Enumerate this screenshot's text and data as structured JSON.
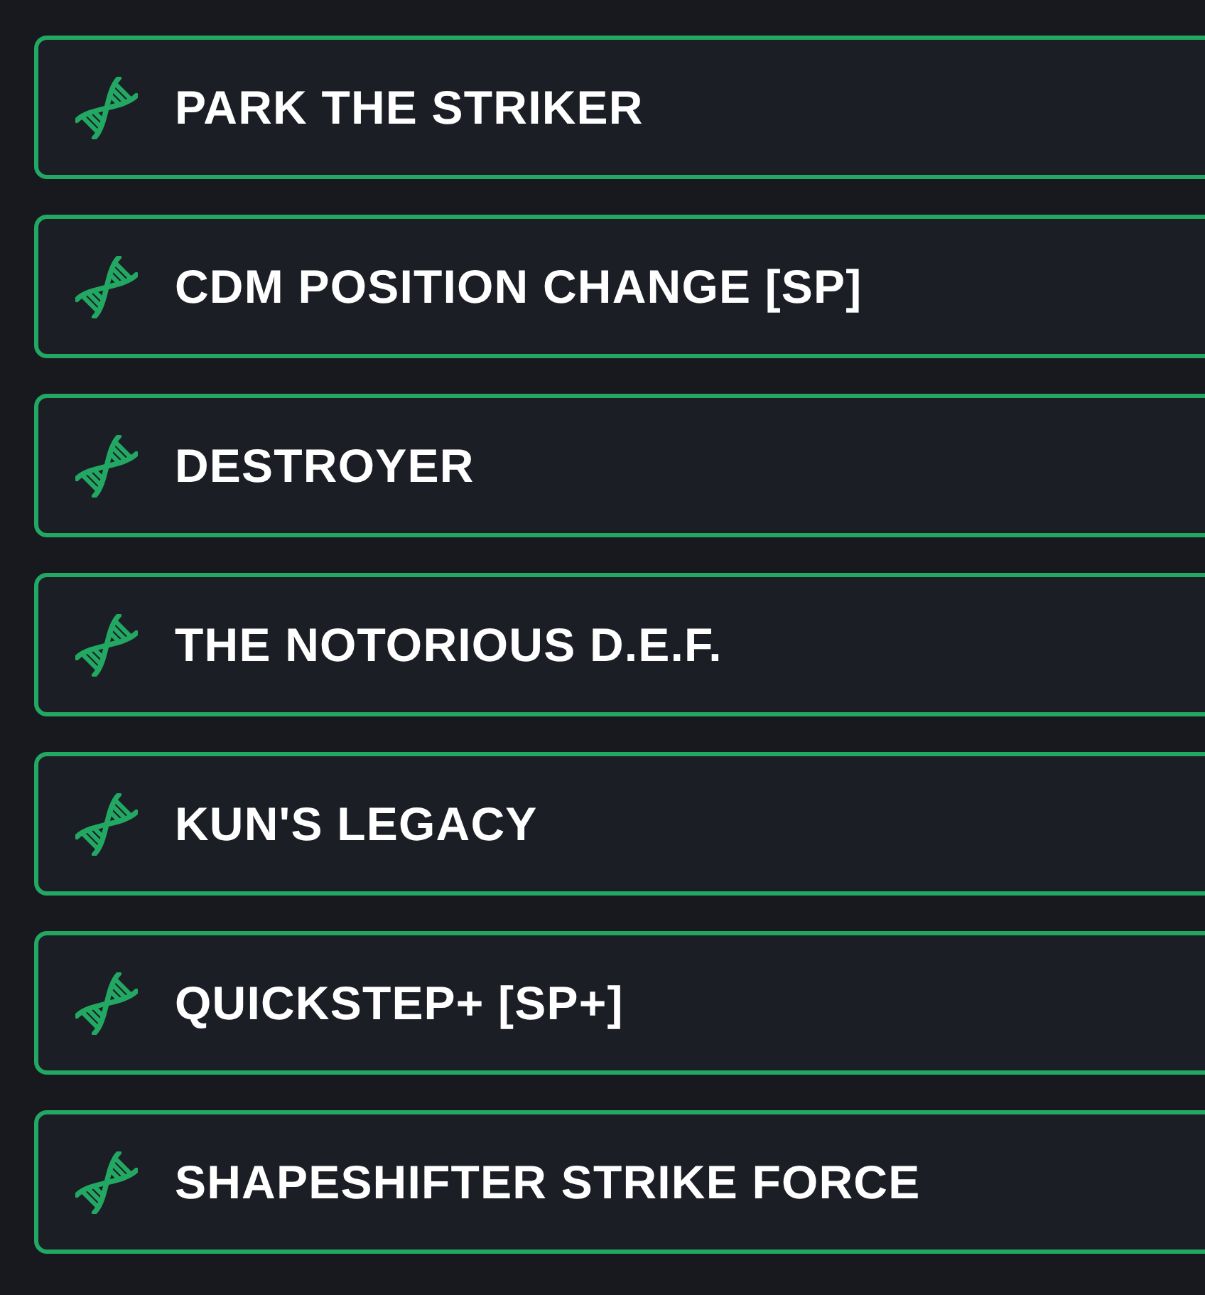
{
  "items": [
    {
      "label": "PARK THE STRIKER"
    },
    {
      "label": "CDM POSITION CHANGE [SP]"
    },
    {
      "label": "DESTROYER"
    },
    {
      "label": "THE NOTORIOUS D.E.F."
    },
    {
      "label": "KUN'S LEGACY"
    },
    {
      "label": "QUICKSTEP+ [SP+]"
    },
    {
      "label": "SHAPESHIFTER STRIKE FORCE"
    }
  ]
}
